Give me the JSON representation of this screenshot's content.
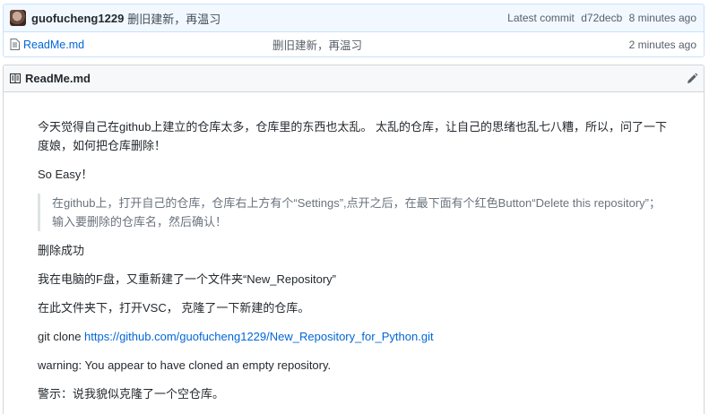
{
  "commit": {
    "author": "guofucheng1229",
    "message": "删旧建新，再温习",
    "latest_label": "Latest commit",
    "hash": "d72decb",
    "age": "8 minutes ago"
  },
  "file": {
    "name": "ReadMe.md",
    "message": "删旧建新，再温习",
    "age": "2 minutes ago"
  },
  "readme": {
    "title": "ReadMe.md",
    "paragraphs": [
      "今天觉得自己在github上建立的仓库太多，仓库里的东西也太乱。 太乱的仓库，让自己的思绪也乱七八糟，所以，问了一下度娘，如何把仓库删除！",
      "So Easy！"
    ],
    "quote": "在github上，打开自己的仓库，仓库右上方有个“Settings”,点开之后，在最下面有个红色Button“Delete this repository”；输入要删除的仓库名，然后确认！",
    "after": [
      "删除成功",
      "我在电脑的F盘，又重新建了一个文件夹“New_Repository”",
      "在此文件夹下，打开VSC， 克隆了一下新建的仓库。"
    ],
    "clone_prefix": "git clone ",
    "clone_url": "https://github.com/guofucheng1229/New_Repository_for_Python.git",
    "warning": "warning: You appear to have cloned an empty repository.",
    "note": "警示：说我貌似克隆了一个空仓库。"
  }
}
